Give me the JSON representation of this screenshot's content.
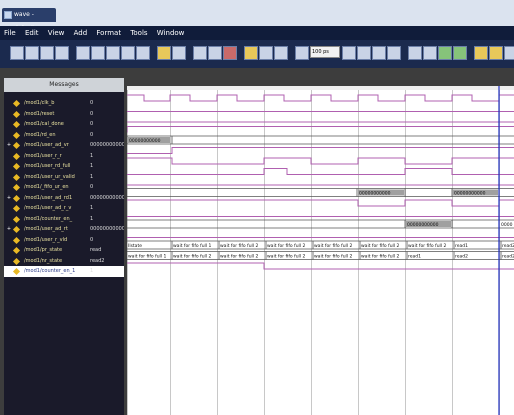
{
  "window": {
    "title": "wave - default"
  },
  "menu": [
    "File",
    "Edit",
    "View",
    "Add",
    "Format",
    "Tools",
    "Window"
  ],
  "toolbar": {
    "time_field": "100 ps"
  },
  "messages_header": "Messages",
  "signals": [
    {
      "name": "/mod1/clk_b",
      "value": "0",
      "expand": ""
    },
    {
      "name": "/mod1/reset",
      "value": "0",
      "expand": ""
    },
    {
      "name": "/mod1/cal_done",
      "value": "0",
      "expand": ""
    },
    {
      "name": "/mod1/rd_en",
      "value": "0",
      "expand": ""
    },
    {
      "name": "/mod1/user_ad_vr",
      "value": "00000000000",
      "expand": "+"
    },
    {
      "name": "/mod1/user_r_r",
      "value": "1",
      "expand": ""
    },
    {
      "name": "/mod1/user_rd_full",
      "value": "1",
      "expand": ""
    },
    {
      "name": "/mod1/user_ur_valid",
      "value": "1",
      "expand": ""
    },
    {
      "name": "/mod1/_fifo_ur_en",
      "value": "0",
      "expand": ""
    },
    {
      "name": "/mod1/user_ad_rd1",
      "value": "00000000000",
      "expand": "+"
    },
    {
      "name": "/mod1/user_ad_r_v",
      "value": "1",
      "expand": ""
    },
    {
      "name": "/mod1/counter_en_",
      "value": "1",
      "expand": ""
    },
    {
      "name": "/mod1/user_ad_rt",
      "value": "00000000000",
      "expand": "+"
    },
    {
      "name": "/mod1/user_r_vld",
      "value": "0",
      "expand": ""
    },
    {
      "name": "/mod1/pr_state",
      "value": "read",
      "expand": ""
    },
    {
      "name": "/mod1/nr_state",
      "value": "read2",
      "expand": ""
    },
    {
      "name": "/mod1/counter_en_1",
      "value": "1",
      "expand": "",
      "selected": true
    }
  ],
  "bus_labels": {
    "row4": [
      "00000000000"
    ],
    "row9": [
      "00000000000",
      "00000000000"
    ],
    "row12": [
      "00000000000",
      "0000"
    ],
    "pr_state": [
      "Ilstate",
      "wait for fifo full 1",
      "wait for fifo full 2",
      "wait for fifo full 2",
      "wait for fifo full 2",
      "wait for fifo full 2",
      "wait for fifo full 2",
      "read1",
      "read2"
    ],
    "nr_state": [
      "wait for fifo full 1",
      "wait for fifo full 2",
      "wait for fifo full 2",
      "wait for fifo full 2",
      "wait for fifo full 2",
      "wait for fifo full 2",
      "read1",
      "read2",
      "read2"
    ]
  },
  "colors": {
    "wave": "#b060b0",
    "bus": "#555555",
    "grid": "#c8c8c8",
    "cursor": "#2030c0",
    "msg_bg": "#1a1a2a",
    "signal_text": "#e8e0a0"
  }
}
